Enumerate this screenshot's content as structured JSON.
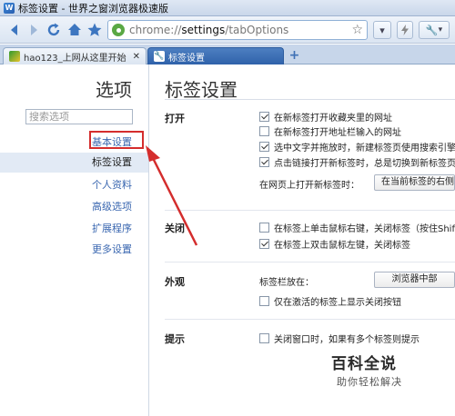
{
  "window": {
    "title": "标签设置 - 世界之窗浏览器极速版"
  },
  "toolbar": {
    "url_prefix": "chrome://",
    "url_bold": "settings",
    "url_suffix": "/tabOptions"
  },
  "tabs": [
    {
      "label": "hao123_上网从这里开始",
      "active": false
    },
    {
      "label": "标签设置",
      "active": true
    }
  ],
  "sidebar": {
    "title": "选项",
    "search_placeholder": "搜索选项",
    "items": [
      {
        "label": "基本设置",
        "selected": false,
        "highlighted": true
      },
      {
        "label": "标签设置",
        "selected": true
      },
      {
        "label": "个人资料",
        "selected": false
      },
      {
        "label": "高级选项",
        "selected": false
      },
      {
        "label": "扩展程序",
        "selected": false
      },
      {
        "label": "更多设置",
        "selected": false
      }
    ]
  },
  "main": {
    "title": "标签设置",
    "sections": {
      "open": {
        "label": "打开",
        "options": [
          {
            "label": "在新标签打开收藏夹里的网址",
            "checked": true
          },
          {
            "label": "在新标签打开地址栏输入的网址",
            "checked": false
          },
          {
            "label": "选中文字并拖放时，新建标签页使用搜索引擎搜",
            "checked": true
          },
          {
            "label": "点击链接打开新标签时，总是切换到新标签页",
            "checked": true
          }
        ],
        "field_label": "在网页上打开新标签时：",
        "field_value": "在当前标签的右侧"
      },
      "close": {
        "label": "关闭",
        "options": [
          {
            "label": "在标签上单击鼠标右键，关闭标签（按住Shift右",
            "checked": false
          },
          {
            "label": "在标签上双击鼠标左键，关闭标签",
            "checked": true
          }
        ]
      },
      "appearance": {
        "label": "外观",
        "field_label": "标签栏放在：",
        "field_value": "浏览器中部",
        "options": [
          {
            "label": "仅在激活的标签上显示关闭按钮",
            "checked": false
          }
        ]
      },
      "tips": {
        "label": "提示",
        "options": [
          {
            "label": "关闭窗口时，如果有多个标签则提示",
            "checked": false
          }
        ]
      }
    }
  },
  "watermark": {
    "line1": "百科全说",
    "line2": "助你轻松解决"
  },
  "colors": {
    "highlight": "#d42d2d",
    "link": "#3a67b0",
    "tab_active": "#2f62aa"
  }
}
